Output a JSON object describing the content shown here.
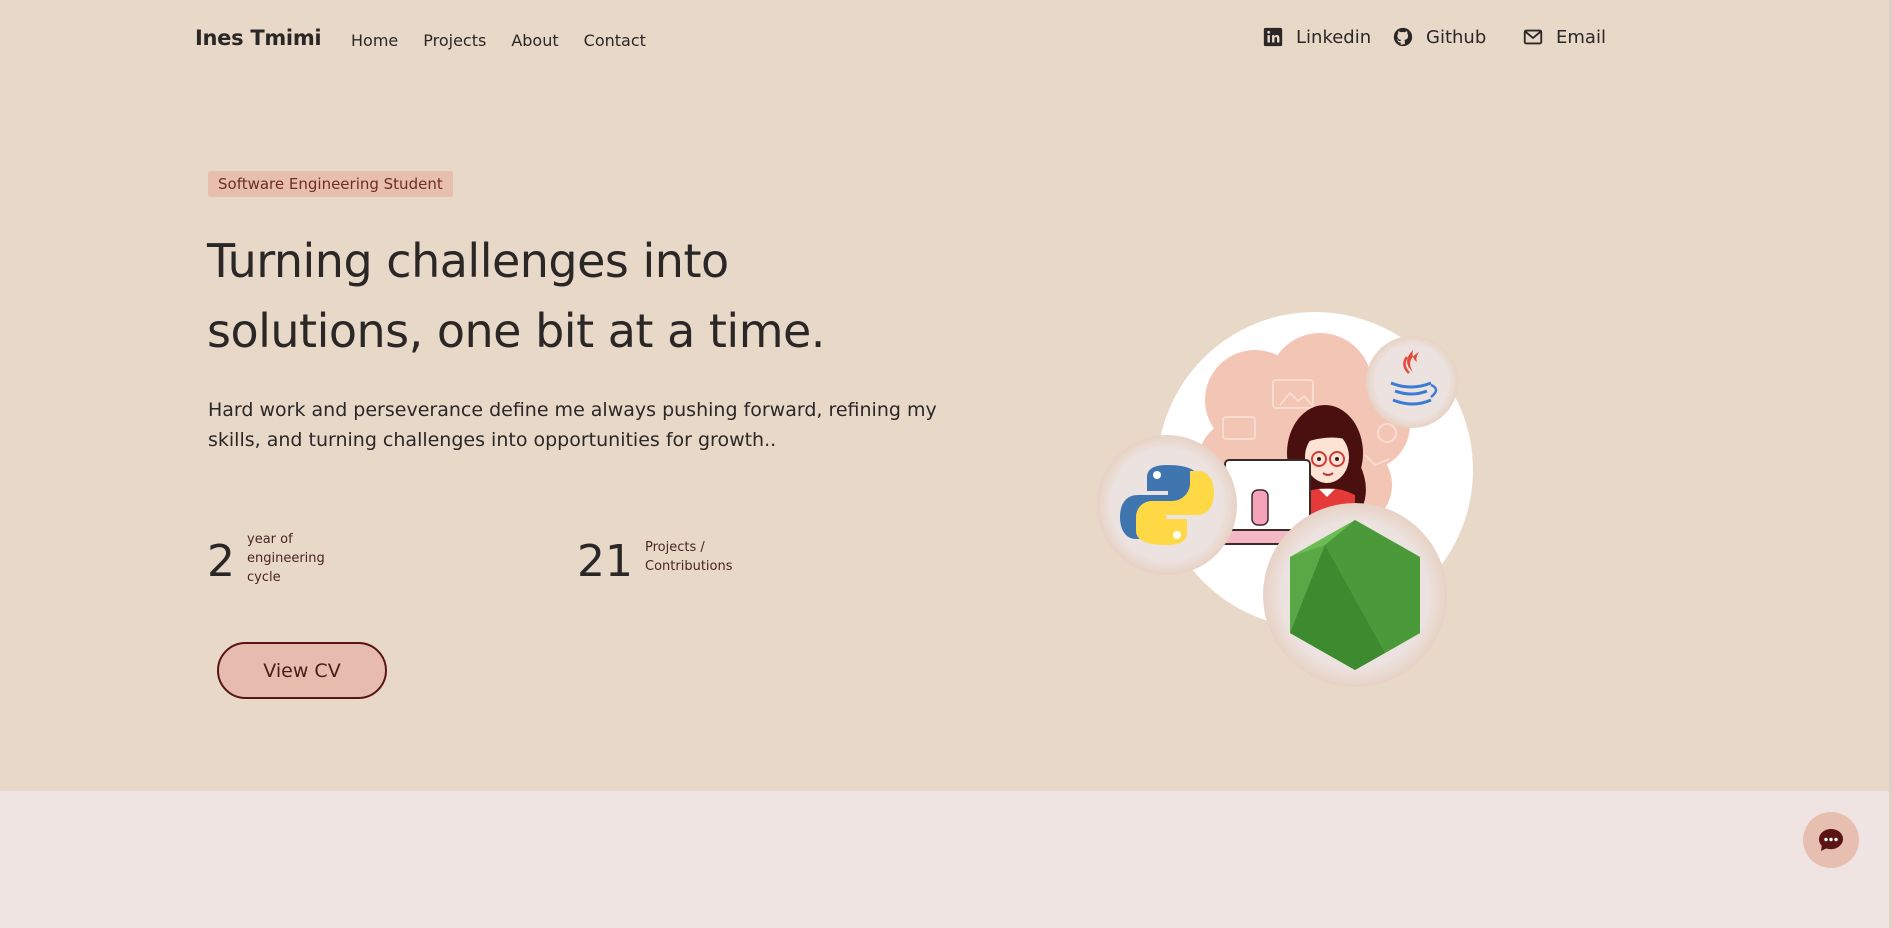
{
  "nav": {
    "brand": "Ines Tmimi",
    "links": [
      "Home",
      "Projects",
      "About",
      "Contact"
    ],
    "social": {
      "linkedin": "Linkedin",
      "github": "Github",
      "email": "Email"
    }
  },
  "hero": {
    "badge": "Software Engineering Student",
    "headline_line1": "Turning challenges into",
    "headline_line2": "solutions, one bit at a time.",
    "description_line1": "Hard work and perseverance define me always pushing forward, refining my",
    "description_line2": "skills, and turning challenges into opportunities for growth..",
    "stats": [
      {
        "value": "2",
        "label_lines": [
          "year of",
          "engineering",
          "cycle"
        ]
      },
      {
        "value": "21",
        "label_lines": [
          "Projects /",
          "Contributions"
        ]
      }
    ],
    "cta_label": "View CV"
  },
  "icons": {
    "linkedin": "linkedin-icon",
    "github": "github-icon",
    "email": "mail-icon",
    "chat": "chat-bubble-icon",
    "python": "python-logo-icon",
    "java": "java-logo-icon",
    "node": "nodejs-logo-icon"
  },
  "colors": {
    "background": "#e8d8c8",
    "lower_section": "#efe4e2",
    "badge_bg": "#e8bfae",
    "button_bg": "#e6bcae",
    "button_border": "#5a1414",
    "text": "#2b2727"
  }
}
